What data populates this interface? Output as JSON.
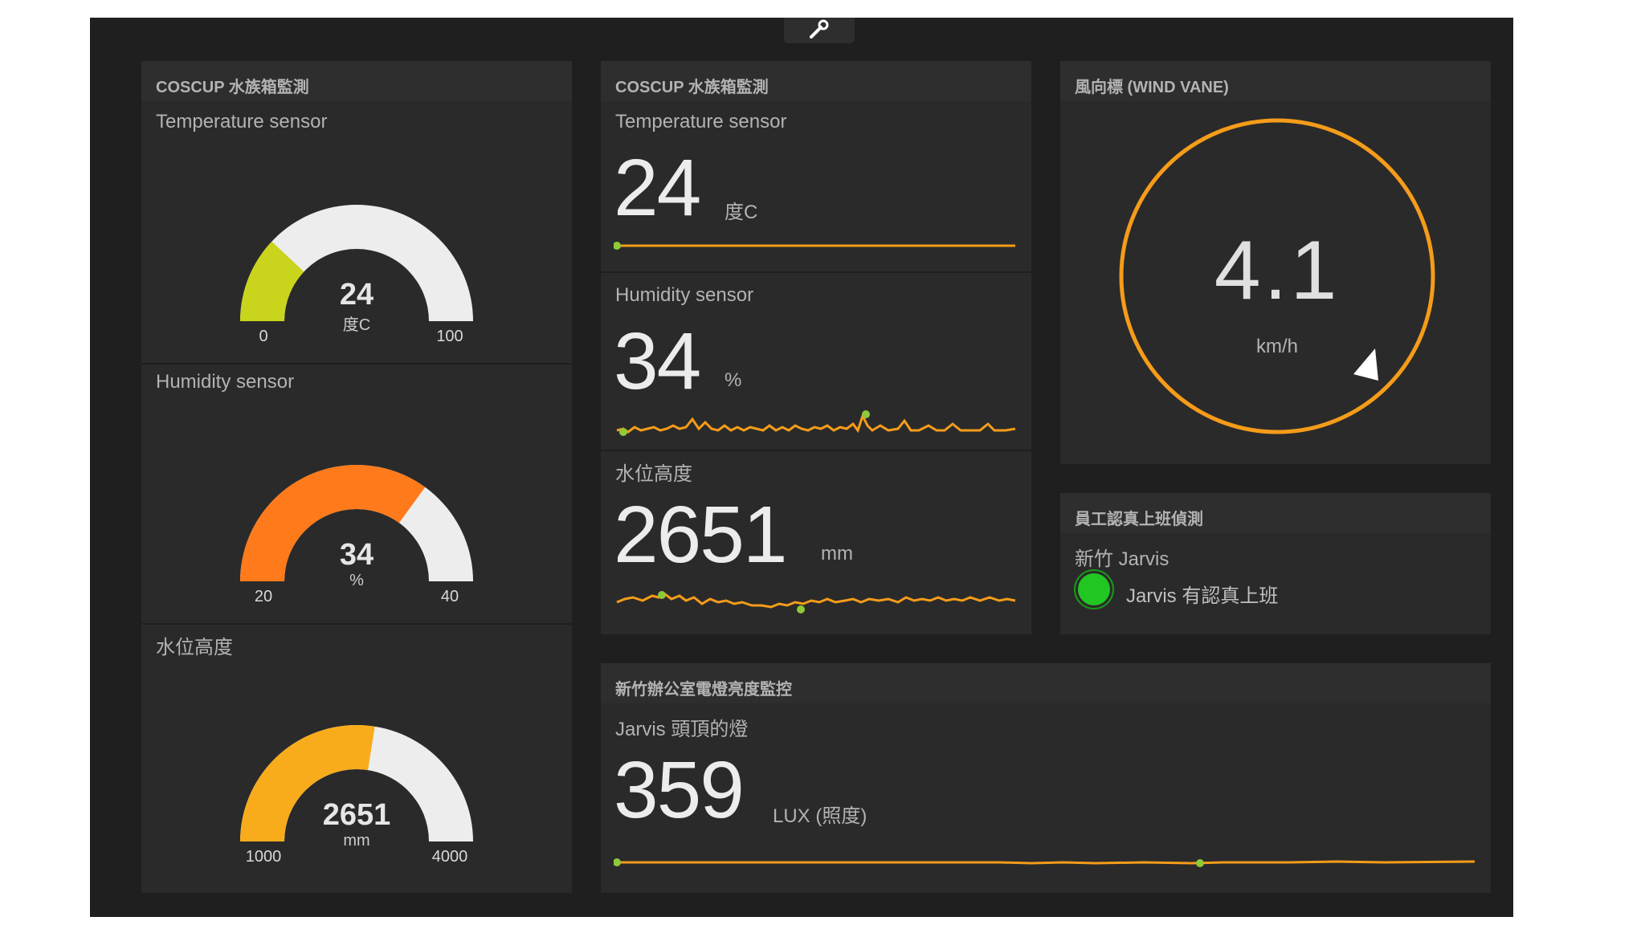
{
  "colors": {
    "accent_orange": "#f59c1a",
    "gauge_empty": "#ededed",
    "gauge_temp": "#c9d41c",
    "gauge_humidity": "#ff7a1a",
    "gauge_water": "#f8ac1c",
    "status_green": "#22c622"
  },
  "pane_left": {
    "title": "COSCUP 水族箱監測",
    "gauges": [
      {
        "title": "Temperature sensor",
        "value": "24",
        "unit": "度C",
        "min": "0",
        "max": "100",
        "fraction": 0.24
      },
      {
        "title": "Humidity sensor",
        "value": "34",
        "unit": "%",
        "min": "20",
        "max": "40",
        "fraction": 0.7
      },
      {
        "title": "水位高度",
        "value": "2651",
        "unit": "mm",
        "min": "1000",
        "max": "4000",
        "fraction": 0.55
      }
    ]
  },
  "pane_mid": {
    "title": "COSCUP 水族箱監測",
    "widgets": [
      {
        "title": "Temperature sensor",
        "value": "24",
        "unit": "度C"
      },
      {
        "title": "Humidity sensor",
        "value": "34",
        "unit": "%"
      },
      {
        "title": "水位高度",
        "value": "2651",
        "unit": "mm"
      }
    ]
  },
  "pane_vane": {
    "title": "風向標 (WIND VANE)",
    "value": "4.1",
    "unit": "km/h",
    "direction_icon": "triangle-pointer-icon"
  },
  "pane_employee": {
    "title": "員工認真上班偵測",
    "location": "新竹 Jarvis",
    "status_text": "Jarvis 有認真上班",
    "status_icon": "status-indicator-icon"
  },
  "pane_light": {
    "title": "新竹辦公室電燈亮度監控",
    "widget_title": "Jarvis 頭頂的燈",
    "value": "359",
    "unit": "LUX (照度)"
  },
  "toolbar": {
    "icon": "wrench-icon"
  }
}
